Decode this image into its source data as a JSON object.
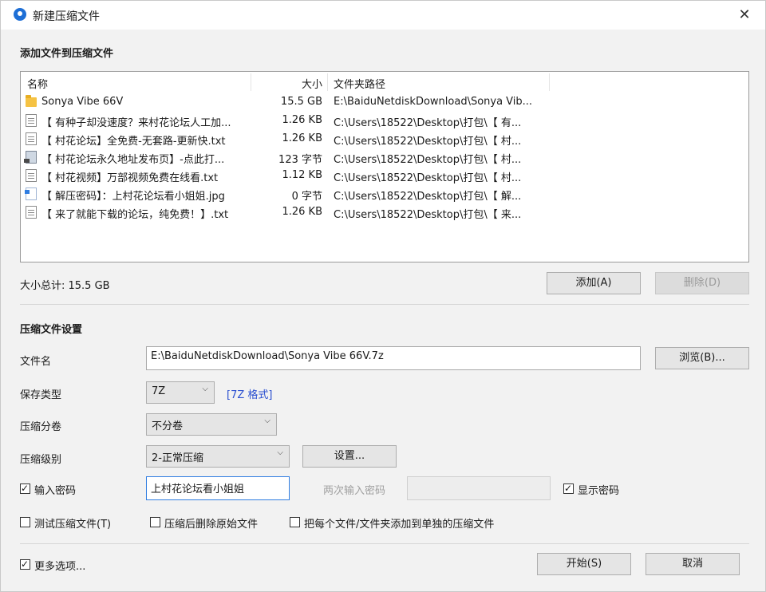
{
  "window": {
    "title": "新建压缩文件"
  },
  "files_section": {
    "heading": "添加文件到压缩文件",
    "columns": {
      "name": "名称",
      "size": "大小",
      "path": "文件夹路径"
    },
    "rows": [
      {
        "icon": "folder-icon",
        "name": "Sonya Vibe 66V",
        "size": "15.5 GB",
        "path": "E:\\BaiduNetdiskDownload\\Sonya Vib..."
      },
      {
        "icon": "text-file-icon",
        "name": "【 有种子却没速度？来村花论坛人工加...",
        "size": "1.26 KB",
        "path": "C:\\Users\\18522\\Desktop\\打包\\【 有..."
      },
      {
        "icon": "text-file-icon",
        "name": "【 村花论坛】全免费-无套路-更新快.txt",
        "size": "1.26 KB",
        "path": "C:\\Users\\18522\\Desktop\\打包\\【 村..."
      },
      {
        "icon": "url-shortcut-icon",
        "name": "【 村花论坛永久地址发布页】-点此打...",
        "size": "123 字节",
        "path": "C:\\Users\\18522\\Desktop\\打包\\【 村..."
      },
      {
        "icon": "text-file-icon",
        "name": "【 村花视频】万部视频免费在线看.txt",
        "size": "1.12 KB",
        "path": "C:\\Users\\18522\\Desktop\\打包\\【 村..."
      },
      {
        "icon": "image-file-icon",
        "name": "【 解压密码】：上村花论坛看小姐姐.jpg",
        "size": "0 字节",
        "path": "C:\\Users\\18522\\Desktop\\打包\\【 解..."
      },
      {
        "icon": "text-file-icon",
        "name": "【 来了就能下载的论坛，纯免费！】.txt",
        "size": "1.26 KB",
        "path": "C:\\Users\\18522\\Desktop\\打包\\【 来..."
      }
    ],
    "total_size": "大小总计: 15.5 GB",
    "add_button": "添加(A)",
    "delete_button": "删除(D)"
  },
  "settings": {
    "heading": "压缩文件设置",
    "filename_label": "文件名",
    "filename_value": "E:\\BaiduNetdiskDownload\\Sonya Vibe 66V.7z",
    "browse_button": "浏览(B)...",
    "type_label": "保存类型",
    "type_value": "7Z",
    "type_link": "[7Z 格式]",
    "split_label": "压缩分卷",
    "split_value": "不分卷",
    "level_label": "压缩级别",
    "level_value": "2-正常压缩",
    "settings_button": "设置...",
    "password_checkbox": "输入密码",
    "password_value": "上村花论坛看小姐姐",
    "confirm_label": "两次输入密码",
    "show_password": "显示密码",
    "test_archive": "测试压缩文件(T)",
    "delete_after": "压缩后删除原始文件",
    "separate_archives": "把每个文件/文件夹添加到单独的压缩文件"
  },
  "footer": {
    "more_options": "更多选项...",
    "start_button": "开始(S)",
    "cancel_button": "取消"
  }
}
